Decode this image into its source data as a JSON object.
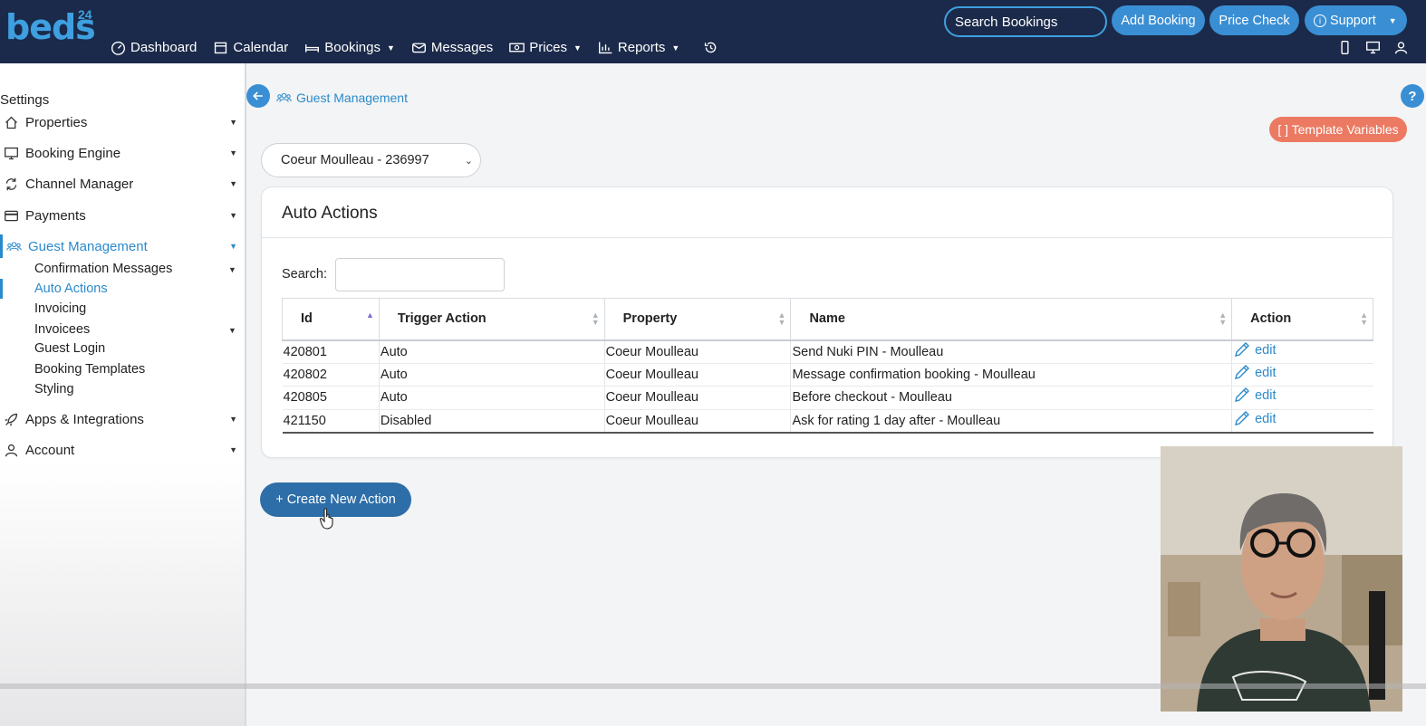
{
  "brand": {
    "logo": "beds",
    "logo_sup": "24"
  },
  "nav": {
    "items": [
      {
        "label": "Dashboard",
        "icon": "gauge-icon",
        "dropdown": false
      },
      {
        "label": "Calendar",
        "icon": "calendar-icon",
        "dropdown": false
      },
      {
        "label": "Bookings",
        "icon": "bed-icon",
        "dropdown": true
      },
      {
        "label": "Messages",
        "icon": "envelope-icon",
        "dropdown": false
      },
      {
        "label": "Prices",
        "icon": "money-icon",
        "dropdown": true
      },
      {
        "label": "Reports",
        "icon": "chart-icon",
        "dropdown": true
      }
    ],
    "history_icon": "history-icon",
    "search_label": "Search Bookings",
    "add_booking": "Add Booking",
    "price_check": "Price Check",
    "support": "Support"
  },
  "sidebar": {
    "title": "Settings",
    "items": [
      {
        "label": "Properties",
        "icon": "home-icon"
      },
      {
        "label": "Booking Engine",
        "icon": "monitor-icon"
      },
      {
        "label": "Channel Manager",
        "icon": "sync-icon"
      },
      {
        "label": "Payments",
        "icon": "card-icon"
      },
      {
        "label": "Guest Management",
        "icon": "users-icon"
      },
      {
        "label": "Apps & Integrations",
        "icon": "rocket-icon"
      },
      {
        "label": "Account",
        "icon": "user-icon"
      }
    ],
    "subitems": [
      {
        "label": "Confirmation Messages",
        "dropdown": true
      },
      {
        "label": "Auto Actions",
        "active": true
      },
      {
        "label": "Invoicing"
      },
      {
        "label": "Invoicees",
        "dropdown": true
      },
      {
        "label": "Guest Login"
      },
      {
        "label": "Booking Templates"
      },
      {
        "label": "Styling"
      }
    ]
  },
  "breadcrumb": {
    "label": "Guest Management"
  },
  "template_variables": "[ ] Template Variables",
  "property_select": "Coeur Moulleau - 236997",
  "card": {
    "title": "Auto Actions",
    "search_label": "Search:",
    "columns": [
      "Id",
      "Trigger Action",
      "Property",
      "Name",
      "Action"
    ],
    "rows": [
      {
        "id": "420801",
        "trigger": "Auto",
        "property": "Coeur Moulleau",
        "name": "Send Nuki PIN - Moulleau",
        "action": "edit"
      },
      {
        "id": "420802",
        "trigger": "Auto",
        "property": "Coeur Moulleau",
        "name": "Message confirmation booking - Moulleau",
        "action": "edit"
      },
      {
        "id": "420805",
        "trigger": "Auto",
        "property": "Coeur Moulleau",
        "name": "Before checkout - Moulleau",
        "action": "edit"
      },
      {
        "id": "421150",
        "trigger": "Disabled",
        "property": "Coeur Moulleau",
        "name": "Ask for rating 1 day after - Moulleau",
        "action": "edit"
      }
    ]
  },
  "create_button": "+ Create New Action",
  "colors": {
    "topbar": "#1b2a4a",
    "accent": "#3a8fd4",
    "link": "#2b8acb",
    "template_var": "#ec7a63",
    "create": "#2d6ea8"
  }
}
